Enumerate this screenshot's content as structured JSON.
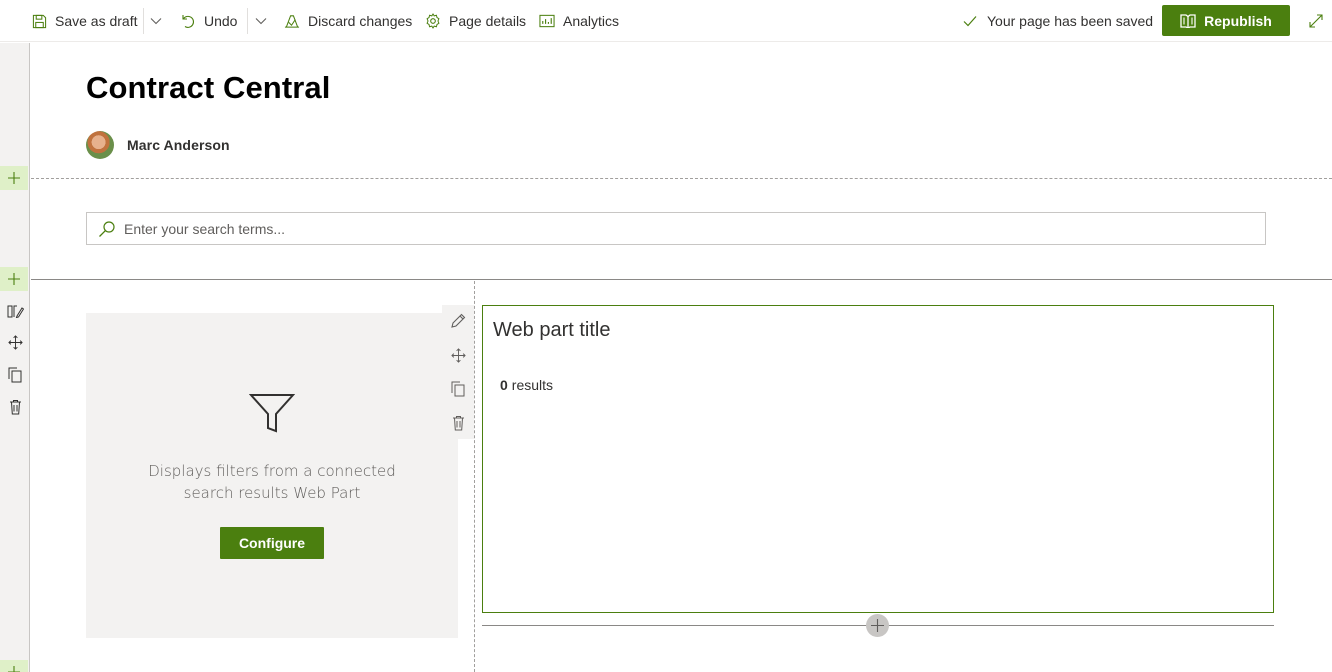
{
  "toolbar": {
    "save_draft": "Save as draft",
    "undo": "Undo",
    "discard": "Discard changes",
    "page_details": "Page details",
    "analytics": "Analytics",
    "status": "Your page has been saved",
    "republish": "Republish"
  },
  "page": {
    "title": "Contract Central",
    "author": "Marc Anderson"
  },
  "search": {
    "placeholder": "Enter your search terms..."
  },
  "filter_webpart": {
    "description_line1": "Displays filters from a connected",
    "description_line2": "search results Web Part",
    "configure": "Configure"
  },
  "results_webpart": {
    "title": "Web part title",
    "count": "0",
    "count_label": "results"
  },
  "colors": {
    "accent": "#4b7f0f",
    "add_bg": "#dff0c8",
    "rail_bg": "#f3f2f1"
  },
  "icons": {
    "save": "save-icon",
    "undo": "undo-icon",
    "discard": "discard-icon",
    "page_details": "gear-icon",
    "analytics": "analytics-icon",
    "check": "check-icon",
    "republish": "book-icon",
    "expand": "expand-icon",
    "search": "search-icon",
    "filter": "filter-icon"
  }
}
